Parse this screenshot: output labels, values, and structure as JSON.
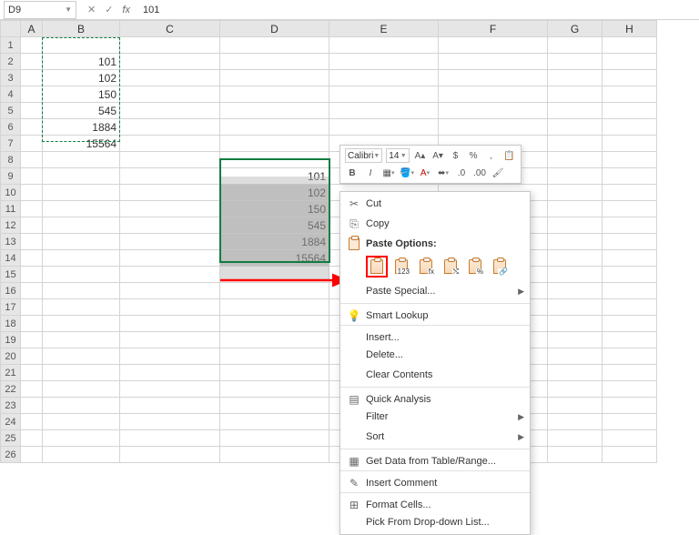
{
  "nameBox": "D9",
  "formulaValue": "101",
  "columns": [
    "A",
    "B",
    "C",
    "D",
    "E",
    "F",
    "G",
    "H"
  ],
  "rows": [
    "1",
    "2",
    "3",
    "4",
    "5",
    "6",
    "7",
    "8",
    "9",
    "10",
    "11",
    "12",
    "13",
    "14",
    "15",
    "16",
    "17",
    "18",
    "19",
    "20",
    "21",
    "22",
    "23",
    "24",
    "25",
    "26"
  ],
  "dataB": [
    "101",
    "102",
    "150",
    "545",
    "1884",
    "15564"
  ],
  "dataD": [
    "101",
    "102",
    "150",
    "545",
    "1884",
    "15564"
  ],
  "miniToolbar": {
    "font": "Calibri",
    "size": "14",
    "incFont": "A",
    "decFont": "A",
    "pct": "%",
    "comma": ",",
    "bold": "B",
    "italic": "I",
    "mergeTip": "Merge"
  },
  "menu": {
    "cut": "Cut",
    "copy": "Copy",
    "pasteOptions": "Paste Options:",
    "pasteSpecial": "Paste Special...",
    "smartLookup": "Smart Lookup",
    "insert": "Insert...",
    "delete": "Delete...",
    "clear": "Clear Contents",
    "quick": "Quick Analysis",
    "filter": "Filter",
    "sort": "Sort",
    "getData": "Get Data from Table/Range...",
    "insertComment": "Insert Comment",
    "formatCells": "Format Cells...",
    "pickList": "Pick From Drop-down List..."
  },
  "pasteSub": {
    "vals": "123",
    "fx": "fx",
    "tp": "⤭",
    "fmt": "%",
    "link": "🔗"
  }
}
